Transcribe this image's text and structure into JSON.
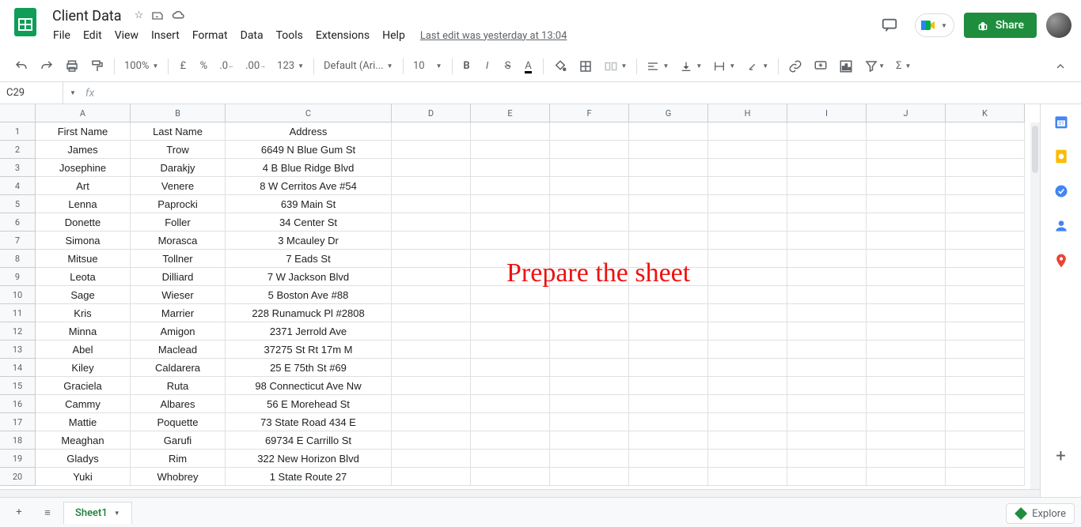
{
  "doc": {
    "title": "Client Data",
    "last_edit": "Last edit was yesterday at 13:04"
  },
  "menu": [
    "File",
    "Edit",
    "View",
    "Insert",
    "Format",
    "Data",
    "Tools",
    "Extensions",
    "Help"
  ],
  "toolbar": {
    "zoom": "100%",
    "font": "Default (Ari...",
    "font_size": "10"
  },
  "share": {
    "label": "Share"
  },
  "namebox": {
    "cell": "C29"
  },
  "columns": [
    "A",
    "B",
    "C",
    "D",
    "E",
    "F",
    "G",
    "H",
    "I",
    "J",
    "K"
  ],
  "rows": [
    {
      "n": "1",
      "a": "First Name",
      "b": "Last Name",
      "c": "Address"
    },
    {
      "n": "2",
      "a": "James",
      "b": "Trow",
      "c": "6649 N Blue Gum St"
    },
    {
      "n": "3",
      "a": "Josephine",
      "b": "Darakjy",
      "c": "4 B Blue Ridge Blvd"
    },
    {
      "n": "4",
      "a": "Art",
      "b": "Venere",
      "c": "8 W Cerritos Ave #54"
    },
    {
      "n": "5",
      "a": "Lenna",
      "b": "Paprocki",
      "c": "639 Main St"
    },
    {
      "n": "6",
      "a": "Donette",
      "b": "Foller",
      "c": "34 Center St"
    },
    {
      "n": "7",
      "a": "Simona",
      "b": "Morasca",
      "c": "3 Mcauley Dr"
    },
    {
      "n": "8",
      "a": "Mitsue",
      "b": "Tollner",
      "c": "7 Eads St"
    },
    {
      "n": "9",
      "a": "Leota",
      "b": "Dilliard",
      "c": "7 W Jackson Blvd"
    },
    {
      "n": "10",
      "a": "Sage",
      "b": "Wieser",
      "c": "5 Boston Ave #88"
    },
    {
      "n": "11",
      "a": "Kris",
      "b": "Marrier",
      "c": "228 Runamuck Pl #2808"
    },
    {
      "n": "12",
      "a": "Minna",
      "b": "Amigon",
      "c": "2371 Jerrold Ave"
    },
    {
      "n": "13",
      "a": "Abel",
      "b": "Maclead",
      "c": "37275 St Rt 17m M"
    },
    {
      "n": "14",
      "a": "Kiley",
      "b": "Caldarera",
      "c": "25 E 75th St #69"
    },
    {
      "n": "15",
      "a": "Graciela",
      "b": "Ruta",
      "c": "98 Connecticut Ave Nw"
    },
    {
      "n": "16",
      "a": "Cammy",
      "b": "Albares",
      "c": "56 E Morehead St"
    },
    {
      "n": "17",
      "a": "Mattie",
      "b": "Poquette",
      "c": "73 State Road 434 E"
    },
    {
      "n": "18",
      "a": "Meaghan",
      "b": "Garufi",
      "c": "69734 E Carrillo St"
    },
    {
      "n": "19",
      "a": "Gladys",
      "b": "Rim",
      "c": "322 New Horizon Blvd"
    },
    {
      "n": "20",
      "a": "Yuki",
      "b": "Whobrey",
      "c": "1 State Route 27"
    }
  ],
  "annotation": "Prepare the sheet",
  "sheet_tab": {
    "name": "Sheet1"
  },
  "explore": {
    "label": "Explore"
  }
}
